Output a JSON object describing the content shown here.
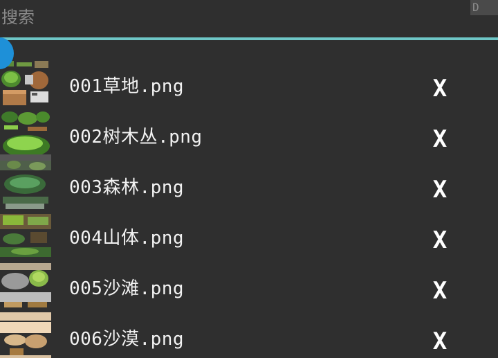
{
  "search": {
    "placeholder": "搜索",
    "button_label": "D"
  },
  "colors": {
    "background": "#2f2f2f",
    "accent_underline": "#6ec6c6",
    "scroll_knob": "#1e90d8",
    "text": "#f2f2f2"
  },
  "files": [
    {
      "name": "001草地.png",
      "delete_label": "X"
    },
    {
      "name": "002树木丛.png",
      "delete_label": "X"
    },
    {
      "name": "003森林.png",
      "delete_label": "X"
    },
    {
      "name": "004山体.png",
      "delete_label": "X"
    },
    {
      "name": "005沙滩.png",
      "delete_label": "X"
    },
    {
      "name": "006沙漠.png",
      "delete_label": "X"
    }
  ]
}
